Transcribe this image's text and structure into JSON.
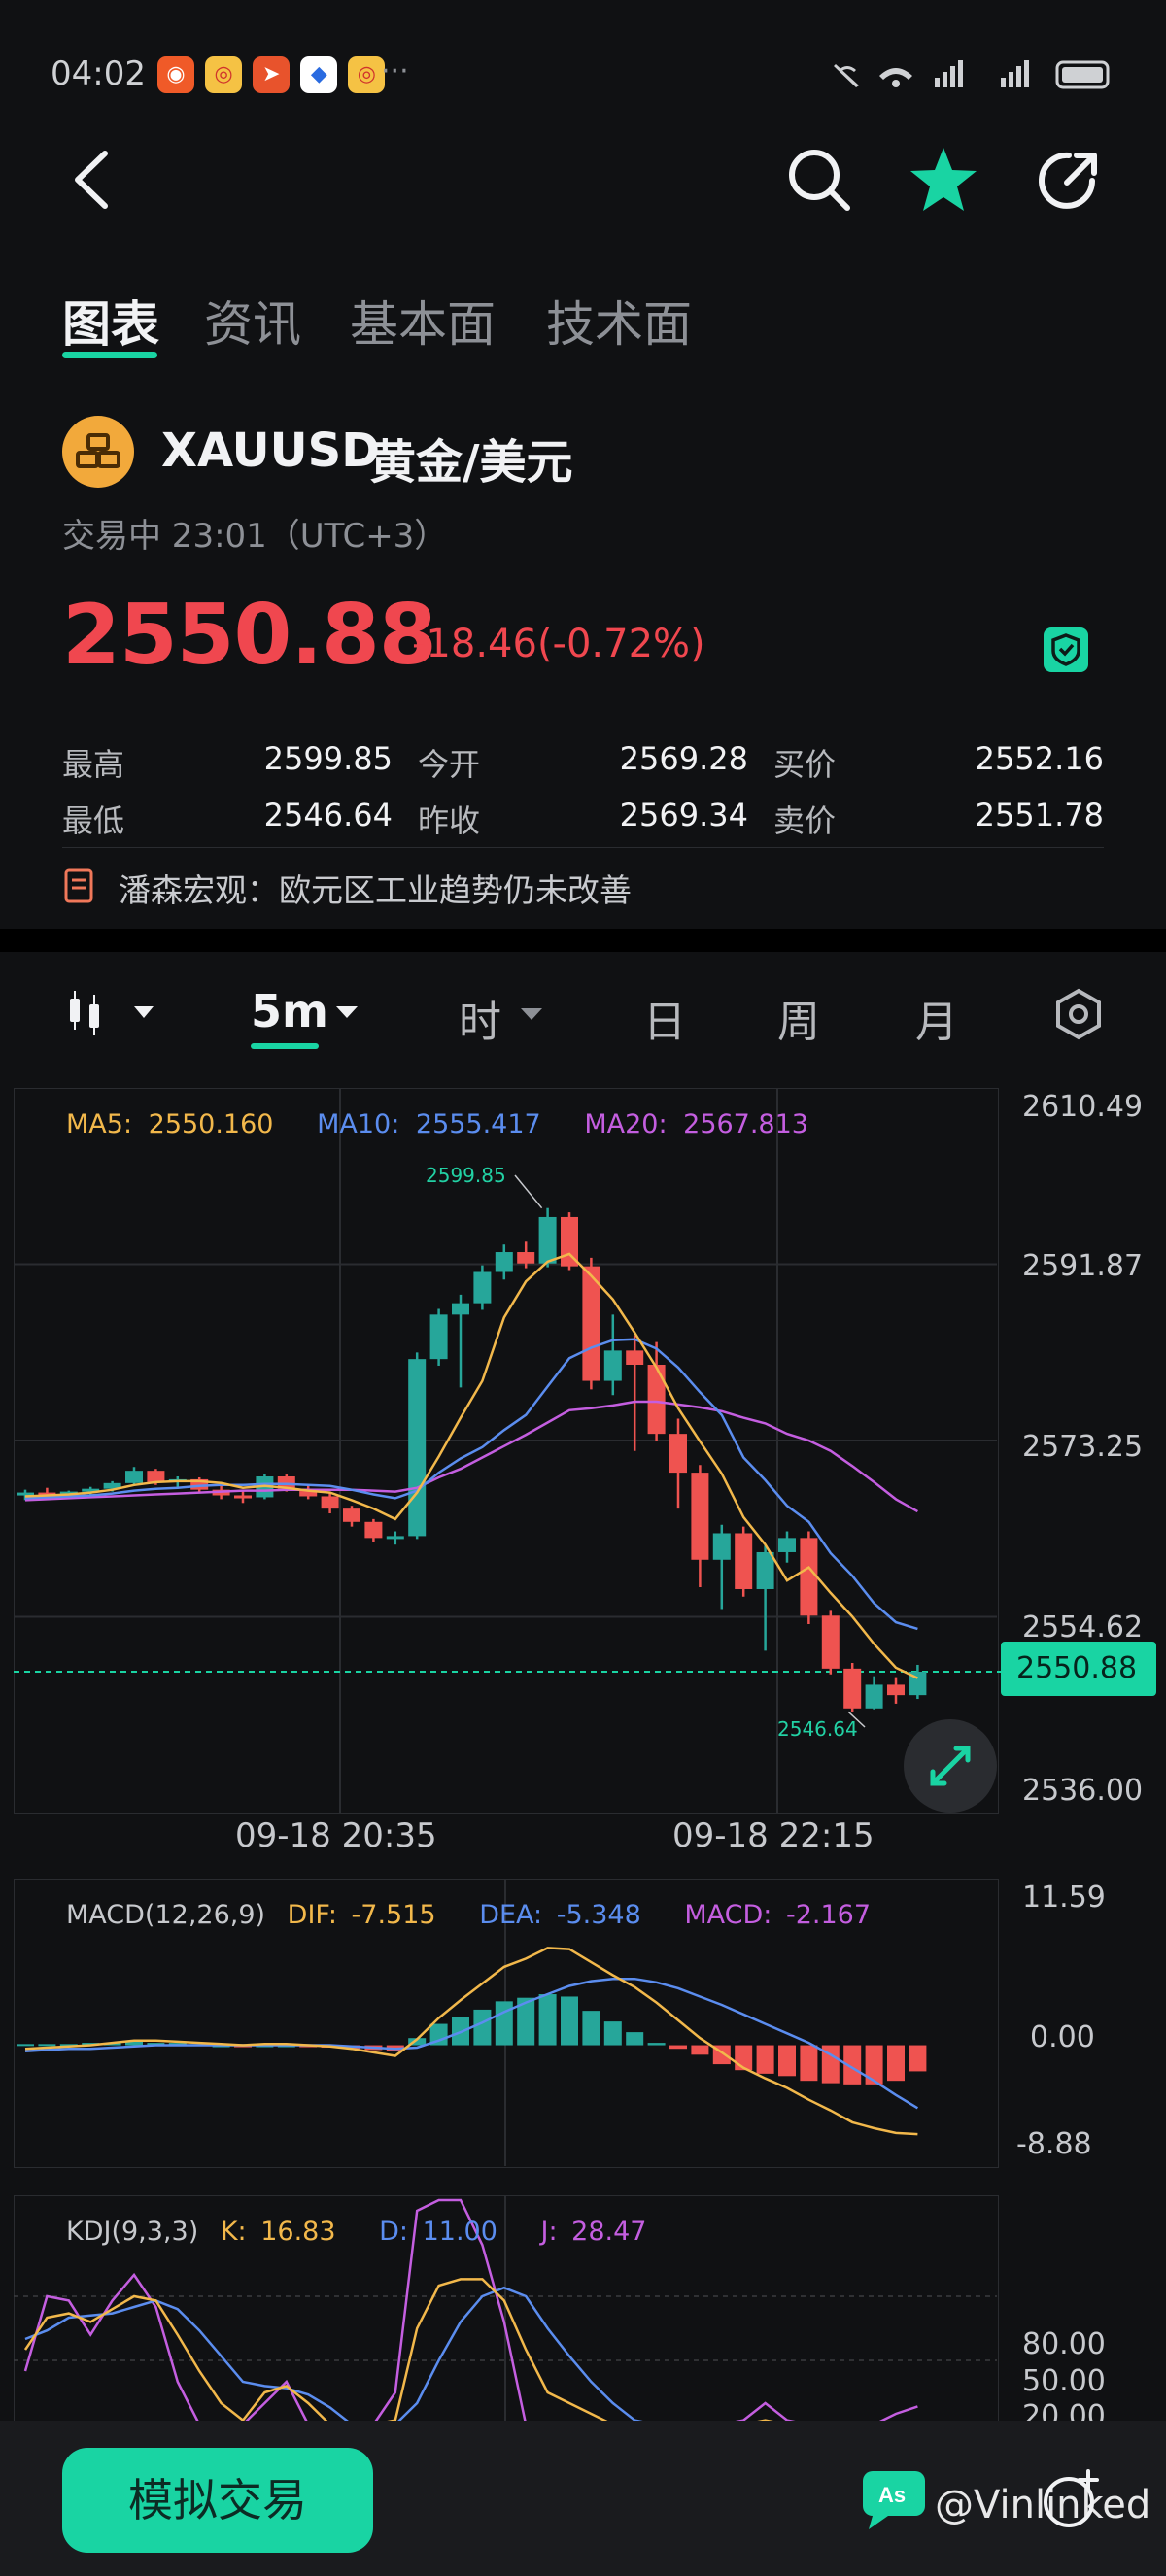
{
  "status_bar": {
    "time": "04:02",
    "dots": "···"
  },
  "tabs": [
    {
      "label": "图表",
      "active": true
    },
    {
      "label": "资讯",
      "active": false
    },
    {
      "label": "基本面",
      "active": false
    },
    {
      "label": "技术面",
      "active": false
    }
  ],
  "symbol": {
    "code": "XAUUSD",
    "name": "黄金/美元",
    "session": "交易中 23:01（UTC+3）",
    "price": "2550.88",
    "change": "-18.46(-0.72%)"
  },
  "stats": {
    "high_label": "最高",
    "high": "2599.85",
    "low_label": "最低",
    "low": "2546.64",
    "open_label": "今开",
    "open": "2569.28",
    "prev_label": "昨收",
    "prev": "2569.34",
    "bid_label": "买价",
    "bid": "2552.16",
    "ask_label": "卖价",
    "ask": "2551.78"
  },
  "news": "潘森宏观：欧元区工业趋势仍未改善",
  "toolbar": {
    "interval": "5m",
    "hour": "时",
    "day": "日",
    "week": "周",
    "month": "月"
  },
  "colors": {
    "up": "#26a69a",
    "down": "#ef5350",
    "accent": "#19d4a3",
    "ma5": "#f2b84b",
    "ma10": "#5b8def",
    "ma20": "#c45ee0"
  },
  "chart_data": [
    {
      "type": "candlestick",
      "legend": {
        "ma5": "MA5:",
        "ma5_val": "2550.160",
        "ma10": "MA10:",
        "ma10_val": "2555.417",
        "ma20": "MA20:",
        "ma20_val": "2567.813"
      },
      "y_ticks": [
        "2610.49",
        "2591.87",
        "2573.25",
        "2554.62",
        "2536.00"
      ],
      "ylim": [
        2536.0,
        2610.49
      ],
      "x_ticks": [
        "09-18 20:35",
        "09-18 22:15"
      ],
      "last_price": "2550.88",
      "high_marker": "2599.85",
      "low_marker": "2546.64",
      "candles": [
        [
          2569.5,
          2570.1,
          2569.0,
          2569.8
        ],
        [
          2569.8,
          2570.3,
          2569.3,
          2569.6
        ],
        [
          2569.6,
          2570.0,
          2569.2,
          2569.9
        ],
        [
          2569.9,
          2570.4,
          2569.5,
          2570.2
        ],
        [
          2570.2,
          2571.0,
          2569.9,
          2570.8
        ],
        [
          2570.8,
          2572.5,
          2570.6,
          2572.1
        ],
        [
          2572.1,
          2572.3,
          2570.6,
          2570.9
        ],
        [
          2570.9,
          2571.5,
          2570.2,
          2571.2
        ],
        [
          2571.2,
          2571.4,
          2569.8,
          2570.1
        ],
        [
          2570.1,
          2570.6,
          2569.1,
          2569.5
        ],
        [
          2569.5,
          2570.1,
          2568.7,
          2569.3
        ],
        [
          2569.3,
          2571.8,
          2569.1,
          2571.5
        ],
        [
          2571.5,
          2571.7,
          2569.9,
          2570.2
        ],
        [
          2570.2,
          2570.6,
          2569.1,
          2569.4
        ],
        [
          2569.4,
          2569.9,
          2567.6,
          2568.1
        ],
        [
          2568.1,
          2568.4,
          2566.2,
          2566.7
        ],
        [
          2566.7,
          2567.0,
          2564.6,
          2565.0
        ],
        [
          2565.0,
          2565.7,
          2564.3,
          2565.2
        ],
        [
          2565.2,
          2584.6,
          2564.9,
          2583.9
        ],
        [
          2583.9,
          2589.2,
          2583.2,
          2588.6
        ],
        [
          2588.6,
          2590.7,
          2580.9,
          2589.8
        ],
        [
          2589.8,
          2593.8,
          2589.1,
          2593.1
        ],
        [
          2593.1,
          2596.0,
          2592.3,
          2595.2
        ],
        [
          2595.2,
          2596.3,
          2593.5,
          2594.0
        ],
        [
          2594.0,
          2599.85,
          2593.6,
          2598.9
        ],
        [
          2598.9,
          2599.4,
          2593.3,
          2593.7
        ],
        [
          2593.7,
          2594.6,
          2580.7,
          2581.6
        ],
        [
          2581.6,
          2588.6,
          2580.1,
          2584.8
        ],
        [
          2584.8,
          2586.4,
          2574.2,
          2583.3
        ],
        [
          2583.3,
          2585.7,
          2575.3,
          2576.0
        ],
        [
          2576.0,
          2577.6,
          2568.1,
          2571.9
        ],
        [
          2571.9,
          2572.7,
          2559.8,
          2562.7
        ],
        [
          2562.7,
          2566.4,
          2557.5,
          2565.5
        ],
        [
          2565.5,
          2566.2,
          2558.8,
          2559.6
        ],
        [
          2559.6,
          2564.2,
          2553.1,
          2563.5
        ],
        [
          2563.5,
          2565.7,
          2562.4,
          2565.0
        ],
        [
          2565.0,
          2565.7,
          2555.9,
          2556.8
        ],
        [
          2556.8,
          2557.3,
          2550.6,
          2551.2
        ],
        [
          2551.2,
          2551.8,
          2546.64,
          2547.0
        ],
        [
          2547.0,
          2550.4,
          2546.9,
          2549.5
        ],
        [
          2549.5,
          2550.3,
          2547.5,
          2548.4
        ],
        [
          2548.4,
          2551.6,
          2548.0,
          2550.88
        ]
      ],
      "ma5_line": [
        2569.4,
        2569.5,
        2569.6,
        2569.8,
        2570.1,
        2570.6,
        2570.9,
        2571.0,
        2571.0,
        2570.8,
        2570.3,
        2570.5,
        2570.3,
        2570.0,
        2569.8,
        2569.0,
        2568.1,
        2567.0,
        2569.8,
        2573.6,
        2577.7,
        2581.6,
        2588.3,
        2592.1,
        2594.2,
        2595.0,
        2592.7,
        2590.2,
        2586.7,
        2583.0,
        2578.7,
        2575.2,
        2571.8,
        2567.2,
        2564.3,
        2560.5,
        2561.9,
        2559.2,
        2556.7,
        2553.8,
        2551.3,
        2550.2
      ],
      "ma10_line": [
        2569.2,
        2569.3,
        2569.4,
        2569.5,
        2569.7,
        2570.0,
        2570.2,
        2570.3,
        2570.5,
        2570.6,
        2570.6,
        2570.7,
        2570.7,
        2570.6,
        2570.5,
        2570.1,
        2569.6,
        2569.2,
        2570.0,
        2571.9,
        2573.4,
        2574.6,
        2576.4,
        2578.0,
        2581.0,
        2584.0,
        2585.1,
        2585.9,
        2586.0,
        2585.0,
        2583.0,
        2580.4,
        2578.0,
        2573.5,
        2571.1,
        2568.4,
        2566.7,
        2563.4,
        2561.0,
        2558.1,
        2556.1,
        2555.4
      ],
      "ma20_line": [
        2569.0,
        2569.1,
        2569.2,
        2569.3,
        2569.4,
        2569.5,
        2569.6,
        2569.7,
        2569.8,
        2569.9,
        2570.0,
        2570.0,
        2570.1,
        2570.1,
        2570.1,
        2570.1,
        2570.0,
        2569.9,
        2570.3,
        2571.4,
        2572.3,
        2573.5,
        2574.7,
        2575.9,
        2577.2,
        2578.5,
        2578.7,
        2579.0,
        2579.4,
        2579.4,
        2579.1,
        2578.8,
        2578.4,
        2577.7,
        2577.1,
        2576.0,
        2575.3,
        2574.2,
        2572.6,
        2570.9,
        2569.1,
        2567.8
      ]
    },
    {
      "type": "macd",
      "legend": {
        "title": "MACD(12,26,9)",
        "dif": "DIF:",
        "dif_val": "-7.515",
        "dea": "DEA:",
        "dea_val": "-5.348",
        "macd": "MACD:",
        "macd_val": "-2.167"
      },
      "y_ticks": [
        "11.59",
        "0.00",
        "-8.88"
      ],
      "ylim": [
        -8.88,
        11.59
      ],
      "hist": [
        0.1,
        0.1,
        0.1,
        0.2,
        0.2,
        0.3,
        0.2,
        0.2,
        0.1,
        0.0,
        -0.1,
        0.0,
        0.0,
        -0.1,
        -0.2,
        -0.3,
        -0.4,
        -0.5,
        0.6,
        1.8,
        2.4,
        3.0,
        3.7,
        4.0,
        4.3,
        4.1,
        2.9,
        2.0,
        1.1,
        0.2,
        -0.3,
        -0.8,
        -1.6,
        -2.1,
        -2.4,
        -2.6,
        -3.0,
        -3.2,
        -3.3,
        -3.3,
        -3.0,
        -2.2
      ],
      "dif": [
        -0.3,
        -0.2,
        -0.1,
        0.0,
        0.2,
        0.4,
        0.4,
        0.3,
        0.2,
        0.1,
        0.0,
        0.1,
        0.1,
        0.0,
        -0.1,
        -0.3,
        -0.6,
        -0.9,
        0.5,
        2.3,
        3.8,
        5.2,
        6.6,
        7.3,
        8.2,
        8.1,
        7.0,
        5.9,
        4.9,
        3.6,
        2.1,
        0.6,
        -0.6,
        -1.9,
        -2.8,
        -3.6,
        -4.6,
        -5.5,
        -6.5,
        -7.0,
        -7.4,
        -7.5
      ],
      "dea": [
        -0.5,
        -0.4,
        -0.3,
        -0.3,
        -0.2,
        -0.1,
        0.0,
        0.0,
        0.0,
        0.0,
        0.0,
        0.0,
        0.0,
        0.0,
        0.0,
        -0.1,
        -0.2,
        -0.3,
        -0.2,
        0.4,
        1.1,
        1.9,
        2.8,
        3.6,
        4.3,
        5.0,
        5.4,
        5.6,
        5.6,
        5.3,
        4.8,
        4.1,
        3.4,
        2.6,
        1.8,
        1.0,
        0.2,
        -0.8,
        -1.9,
        -3.0,
        -4.2,
        -5.3
      ]
    },
    {
      "type": "kdj",
      "legend": {
        "title": "KDJ(9,3,3)",
        "k": "K:",
        "k_val": "16.83",
        "d": "D:",
        "d_val": "11.00",
        "j": "J:",
        "j_val": "28.47"
      },
      "y_ticks": [
        "80.00",
        "50.00",
        "20.00"
      ],
      "k": [
        55,
        70,
        72,
        68,
        74,
        80,
        78,
        62,
        45,
        30,
        22,
        35,
        38,
        30,
        18,
        10,
        8,
        22,
        65,
        85,
        88,
        88,
        78,
        55,
        35,
        30,
        25,
        20,
        15,
        10,
        12,
        15,
        16,
        18,
        22,
        20,
        15,
        12,
        14,
        16,
        17,
        16.8
      ],
      "d": [
        60,
        64,
        70,
        71,
        72,
        75,
        78,
        74,
        64,
        52,
        40,
        38,
        37,
        34,
        28,
        20,
        15,
        15,
        30,
        50,
        68,
        80,
        84,
        80,
        65,
        52,
        40,
        30,
        22,
        16,
        13,
        13,
        14,
        16,
        18,
        19,
        17,
        15,
        14,
        15,
        16,
        11.0
      ],
      "j": [
        45,
        80,
        78,
        62,
        78,
        90,
        75,
        40,
        10,
        0,
        0,
        30,
        40,
        20,
        0,
        0,
        0,
        35,
        120,
        140,
        128,
        104,
        68,
        20,
        0,
        0,
        0,
        0,
        0,
        0,
        10,
        20,
        20,
        22,
        30,
        22,
        10,
        6,
        14,
        20,
        25,
        28.47
      ]
    }
  ],
  "bottom": {
    "button": "模拟交易",
    "watermark": "@Vinlinked"
  }
}
